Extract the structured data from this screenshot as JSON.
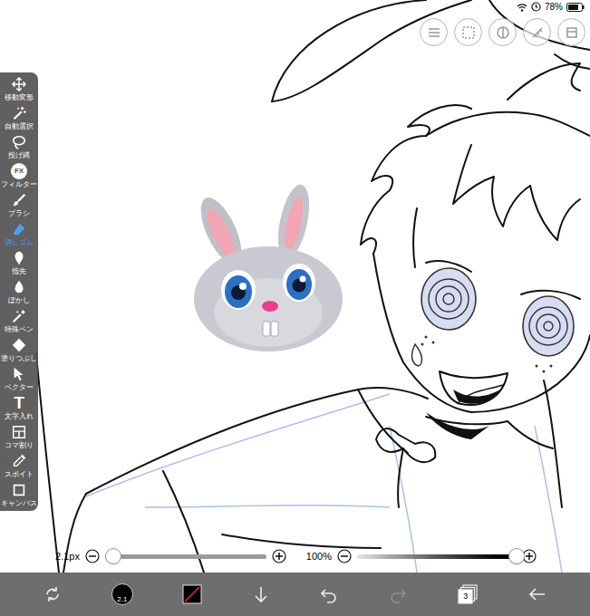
{
  "status_bar": {
    "battery": "78%"
  },
  "tools": [
    {
      "label": "移動変形",
      "selected": false
    },
    {
      "label": "自動選択",
      "selected": false
    },
    {
      "label": "投げ縄",
      "selected": false
    },
    {
      "label": "フィルター",
      "selected": false,
      "icon_text": "FX"
    },
    {
      "label": "ブラシ",
      "selected": false
    },
    {
      "label": "消しゴム",
      "selected": true
    },
    {
      "label": "指先",
      "selected": false
    },
    {
      "label": "ぼかし",
      "selected": false
    },
    {
      "label": "特殊ペン",
      "selected": false
    },
    {
      "label": "塗りつぶし",
      "selected": false
    },
    {
      "label": "ベクター",
      "selected": false
    },
    {
      "label": "文字入れ",
      "selected": false,
      "icon_text": "T"
    },
    {
      "label": "コマ割り",
      "selected": false
    },
    {
      "label": "スポイト",
      "selected": false
    },
    {
      "label": "キャンバス",
      "selected": false
    }
  ],
  "brush_size": {
    "reading": "2.1px",
    "level": 0.05
  },
  "opacity": {
    "reading": "100%",
    "level": 1
  },
  "toolbar": {
    "brush_size": "2.1",
    "layer_count": "3",
    "redo": {
      "disabled": true
    }
  }
}
